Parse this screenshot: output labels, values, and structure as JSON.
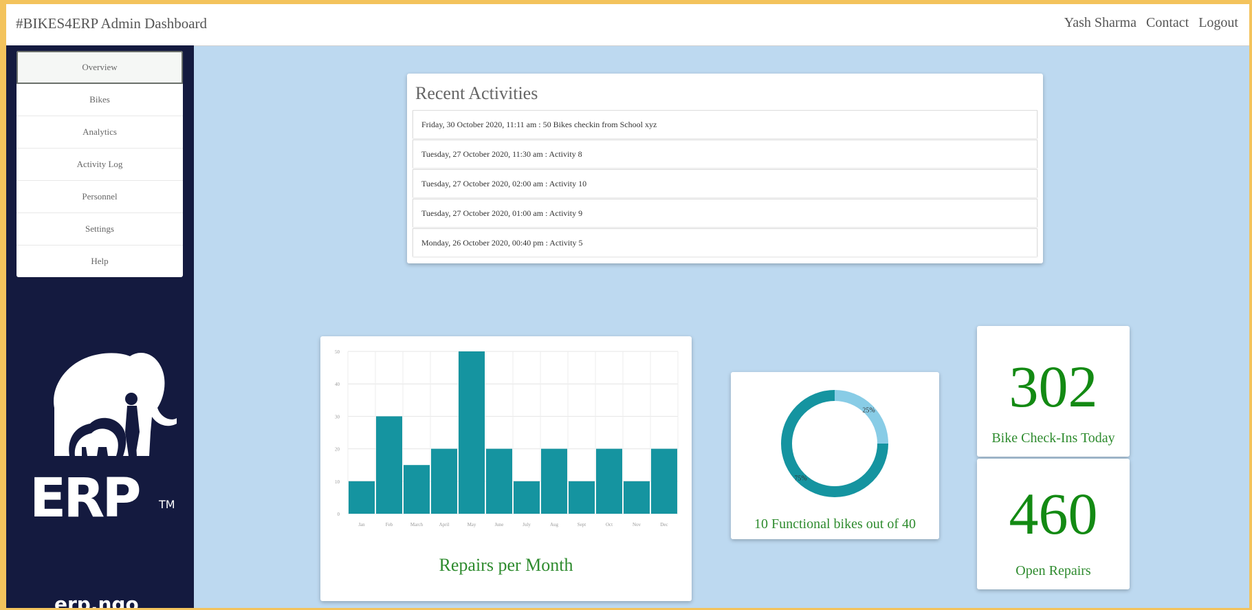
{
  "header": {
    "brand": "#BIKES4ERP Admin Dashboard",
    "nav": [
      "Yash Sharma",
      "Contact",
      "Logout"
    ]
  },
  "sidebar": {
    "items": [
      "Overview",
      "Bikes",
      "Analytics",
      "Activity Log",
      "Personnel",
      "Settings",
      "Help"
    ],
    "active": "Overview",
    "logo_text": "ERP",
    "logo_tm": "TM",
    "url": "erp.ngo"
  },
  "activities": {
    "title": "Recent Activities",
    "items": [
      "Friday, 30 October 2020, 11:11 am : 50 Bikes checkin from School xyz",
      "Tuesday, 27 October 2020, 11:30 am : Activity 8",
      "Tuesday, 27 October 2020, 02:00 am : Activity 10",
      "Tuesday, 27 October 2020, 01:00 am : Activity 9",
      "Monday, 26 October 2020, 00:40 pm : Activity 5"
    ]
  },
  "chart_data": [
    {
      "type": "bar",
      "title": "Repairs per Month",
      "categories": [
        "Jan",
        "Feb",
        "March",
        "April",
        "May",
        "June",
        "July",
        "Aug",
        "Sept",
        "Oct",
        "Nov",
        "Dec"
      ],
      "values": [
        10,
        30,
        15,
        20,
        50,
        20,
        10,
        20,
        10,
        20,
        10,
        20
      ],
      "yticks": [
        0,
        10,
        20,
        30,
        40,
        50
      ],
      "ylim": [
        0,
        50
      ],
      "grid": true,
      "color": "#1594a0"
    },
    {
      "type": "pie",
      "title": "10 Functional bikes out of 40",
      "slices": [
        {
          "label": "25%",
          "value": 25,
          "color": "#88cce6"
        },
        {
          "label": "75%",
          "value": 75,
          "color": "#1594a0"
        }
      ]
    }
  ],
  "stats": [
    {
      "value": "302",
      "label": "Bike Check-Ins Today"
    },
    {
      "value": "460",
      "label": "Open Repairs"
    }
  ],
  "colors": {
    "background": "#bdd9f0",
    "sidebar": "#141a3f",
    "accent_green": "#138a13",
    "bar": "#1594a0"
  }
}
